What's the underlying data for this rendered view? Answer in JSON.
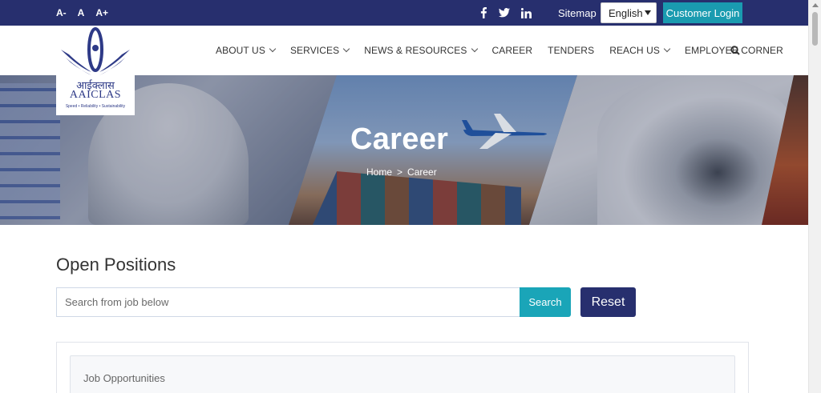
{
  "topbar": {
    "font_sizes": [
      "A-",
      "A",
      "A+"
    ],
    "social_icons": [
      "facebook-icon",
      "twitter-icon",
      "linkedin-icon"
    ],
    "sitemap_label": "Sitemap",
    "language_selected": "English",
    "customer_login_label": "Customer Login"
  },
  "logo": {
    "hindi_text": "आईक्लास",
    "name": "AAICLAS",
    "tagline": "Speed • Reliability • Sustainability"
  },
  "nav": {
    "items": [
      {
        "label": "ABOUT US",
        "has_dropdown": true
      },
      {
        "label": "SERVICES",
        "has_dropdown": true
      },
      {
        "label": "NEWS & RESOURCES",
        "has_dropdown": true
      },
      {
        "label": "CAREER",
        "has_dropdown": false
      },
      {
        "label": "TENDERS",
        "has_dropdown": false
      },
      {
        "label": "REACH US",
        "has_dropdown": true
      },
      {
        "label": "EMPLOYEE CORNER",
        "has_dropdown": false
      }
    ],
    "search_icon": "search-icon"
  },
  "hero": {
    "title": "Career",
    "breadcrumb": {
      "home": "Home",
      "separator": ">",
      "current": "Career"
    }
  },
  "main": {
    "section_title": "Open Positions",
    "search_placeholder": "Search from job below",
    "search_button": "Search",
    "reset_button": "Reset",
    "panel_title": "Job Opportunities"
  },
  "colors": {
    "primary": "#272f6e",
    "accent": "#1aa5b8"
  }
}
